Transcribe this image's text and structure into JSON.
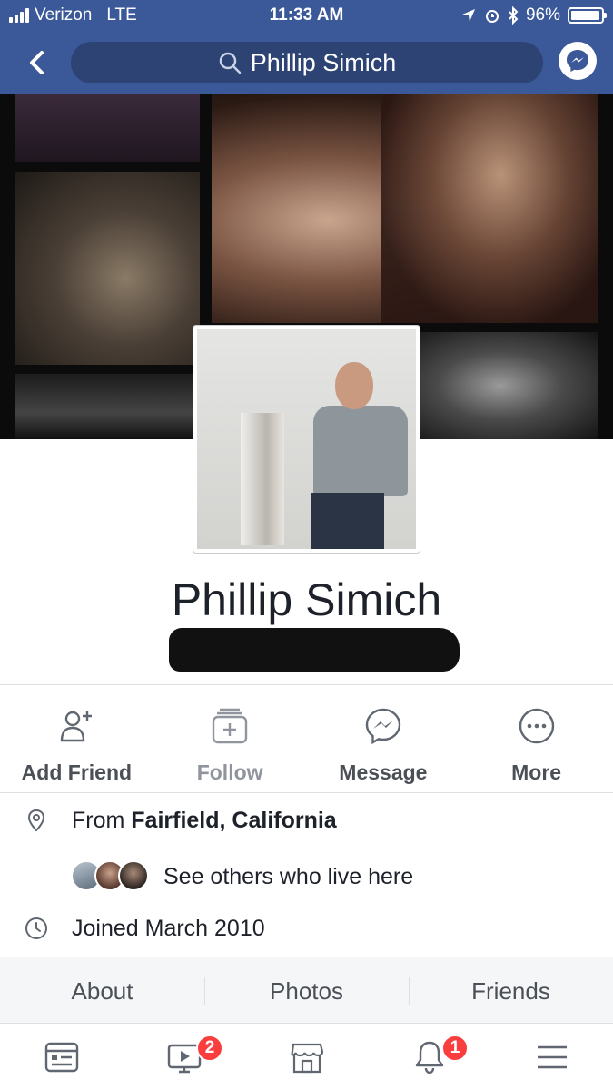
{
  "status_bar": {
    "carrier": "Verizon",
    "network": "LTE",
    "time": "11:33 AM",
    "battery": "96%",
    "battery_level": 0.96
  },
  "nav": {
    "search_text": "Phillip Simich",
    "back_icon": "chevron-left-icon",
    "messenger_icon": "messenger-icon"
  },
  "profile": {
    "name": "Phillip Simich"
  },
  "actions": [
    {
      "label": "Add Friend",
      "icon": "add-friend-icon"
    },
    {
      "label": "Follow",
      "icon": "follow-icon"
    },
    {
      "label": "Message",
      "icon": "messenger-icon"
    },
    {
      "label": "More",
      "icon": "more-icon"
    }
  ],
  "intro": {
    "from_prefix": "From ",
    "from_place": "Fairfield, California",
    "see_others": "See others who live here",
    "joined": "Joined March 2010"
  },
  "tabs": [
    "About",
    "Photos",
    "Friends"
  ],
  "bottom_nav": {
    "items": [
      "news-feed-icon",
      "watch-icon",
      "marketplace-icon",
      "notifications-icon",
      "menu-icon"
    ],
    "watch_badge": "2",
    "notifications_badge": "1"
  },
  "colors": {
    "brand": "#3b5998",
    "badge": "#fa3e3e"
  }
}
